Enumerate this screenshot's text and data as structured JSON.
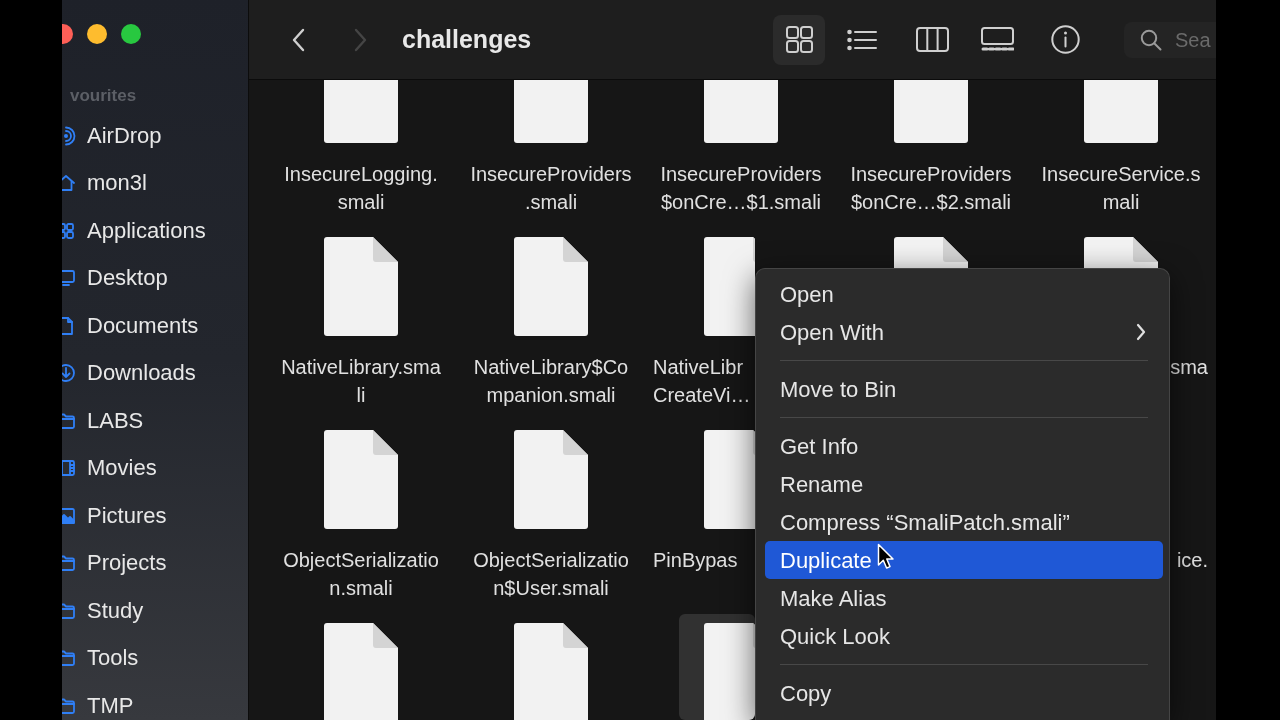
{
  "sidebar": {
    "section": "vourites",
    "items": [
      {
        "label": "AirDrop",
        "kind": "airdrop"
      },
      {
        "label": "mon3l",
        "kind": "home"
      },
      {
        "label": "Applications",
        "kind": "applications"
      },
      {
        "label": "Desktop",
        "kind": "desktop"
      },
      {
        "label": "Documents",
        "kind": "documents"
      },
      {
        "label": "Downloads",
        "kind": "downloads"
      },
      {
        "label": "LABS",
        "kind": "folder"
      },
      {
        "label": "Movies",
        "kind": "movies"
      },
      {
        "label": "Pictures",
        "kind": "pictures"
      },
      {
        "label": "Projects",
        "kind": "folder"
      },
      {
        "label": "Study",
        "kind": "folder"
      },
      {
        "label": "Tools",
        "kind": "folder"
      },
      {
        "label": "TMP",
        "kind": "folder"
      }
    ]
  },
  "toolbar": {
    "navigation": [
      {
        "kind": "back",
        "disabled": false
      },
      {
        "kind": "forward",
        "disabled": true
      }
    ],
    "title": "challenges",
    "views": [
      {
        "kind": "icons",
        "selected": true
      },
      {
        "kind": "list",
        "selected": false
      },
      {
        "kind": "columns",
        "selected": false
      },
      {
        "kind": "gallery",
        "selected": false
      }
    ],
    "search": {
      "placeholder": "Sea"
    }
  },
  "files": {
    "rows": [
      [
        {
          "label": [
            "InsecureLogging.",
            "smali"
          ],
          "selected": false
        },
        {
          "label": [
            "InsecureProviders",
            ".smali"
          ],
          "selected": false
        },
        {
          "label": [
            "InsecureProviders",
            "$onCre…$1.smali"
          ],
          "selected": false
        },
        {
          "label": [
            "InsecureProviders",
            "$onCre…$2.smali"
          ],
          "selected": false
        },
        {
          "label": [
            "InsecureService.s",
            "mali"
          ],
          "selected": false
        }
      ],
      [
        {
          "label": [
            "NativeLibrary.sma",
            "li"
          ],
          "selected": false
        },
        {
          "label": [
            "NativeLibrary$Co",
            "mpanion.smali"
          ],
          "selected": false
        },
        {
          "label": [
            "NativeLibr",
            "CreateVi…"
          ],
          "selected": false
        },
        {
          "selected": false
        },
        {
          "label": [
            "sma"
          ],
          "selected": false
        }
      ],
      [
        {
          "label": [
            "ObjectSerializatio",
            "n.smali"
          ],
          "selected": false
        },
        {
          "label": [
            "ObjectSerializatio",
            "n$User.smali"
          ],
          "selected": false
        },
        {
          "label": [
            "PinBypas"
          ],
          "selected": false
        },
        null,
        {
          "label": [
            "ice."
          ]
        }
      ],
      [
        {
          "selected": false
        },
        {
          "selected": false
        },
        {
          "selected": true
        },
        null,
        null
      ]
    ]
  },
  "context_menu": {
    "groups": [
      [
        {
          "label": "Open",
          "submenu": false,
          "selected": false
        },
        {
          "label": "Open With",
          "submenu": true,
          "selected": false
        }
      ],
      [
        {
          "label": "Move to Bin",
          "submenu": false,
          "selected": false
        }
      ],
      [
        {
          "label": "Get Info",
          "submenu": false,
          "selected": false
        },
        {
          "label": "Rename",
          "submenu": false,
          "selected": false
        },
        {
          "label": "Compress “SmaliPatch.smali”",
          "submenu": false,
          "selected": false
        },
        {
          "label": "Duplicate",
          "submenu": false,
          "selected": true
        },
        {
          "label": "Make Alias",
          "submenu": false,
          "selected": false
        },
        {
          "label": "Quick Look",
          "submenu": false,
          "selected": false
        }
      ],
      [
        {
          "label": "Copy",
          "submenu": false,
          "selected": false
        }
      ]
    ]
  }
}
